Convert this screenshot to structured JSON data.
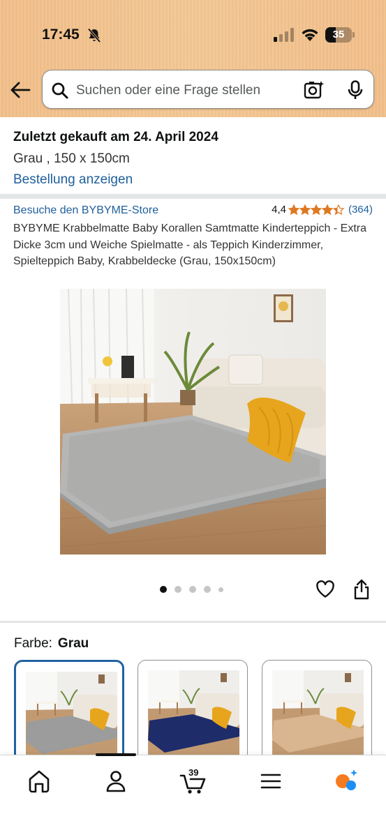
{
  "status_bar": {
    "time": "17:45",
    "battery_percent": "35",
    "icons": [
      "bell-slash-icon",
      "signal-icon",
      "wifi-icon",
      "battery-icon"
    ]
  },
  "search": {
    "placeholder": "Suchen oder eine Frage stellen",
    "icons": [
      "back-arrow-icon",
      "search-icon",
      "camera-icon",
      "mic-icon"
    ]
  },
  "order": {
    "title": "Zuletzt gekauft am 24. April 2024",
    "variant": "Grau , 150 x 150cm",
    "link": "Bestellung anzeigen"
  },
  "product": {
    "store_link": "Besuche den BYBYME-Store",
    "rating_value": "4,4",
    "rating_stars": 4.4,
    "rating_count": "(364)",
    "title": "BYBYME Krabbelmatte Baby Korallen Samtmatte Kinderteppich - Extra Dicke 3cm und Weiche Spielmatte - als Teppich Kinderzimmer, Spielteppich Baby, Krabbeldecke (Grau, 150x150cm)",
    "image_count": 5,
    "active_image": 1,
    "actions": [
      "heart-icon",
      "share-icon"
    ]
  },
  "color": {
    "label": "Farbe:",
    "selected": "Grau",
    "swatches": [
      {
        "name": "grey",
        "hex": "#9b9c9b"
      },
      {
        "name": "navy",
        "hex": "#1e2c6a"
      },
      {
        "name": "beige",
        "hex": "#d9b690"
      }
    ]
  },
  "nav": {
    "cart_count": "39",
    "items": [
      "home-icon",
      "account-icon",
      "cart-icon",
      "menu-icon",
      "rufus-icon"
    ]
  },
  "colors": {
    "header": "#f3c48f",
    "link": "#1f5f9c",
    "star": "#de7921",
    "selected_border": "#2162a1"
  }
}
